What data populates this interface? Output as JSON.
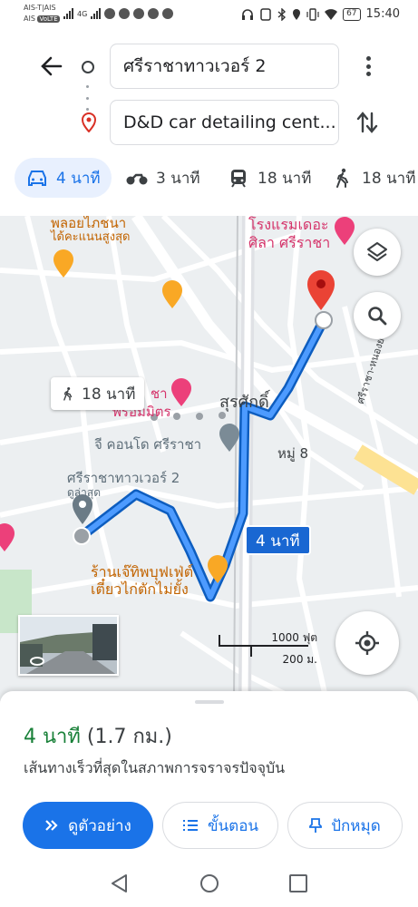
{
  "status_bar": {
    "carrier1": "AIS-T|AIS",
    "carrier2": "AIS",
    "carrier2_badge": "VoLTE",
    "network": "4G",
    "battery": "67",
    "time": "15:40"
  },
  "route": {
    "origin": "ศรีราชาทาวเวอร์ 2",
    "destination": "D&D car detailing cent..."
  },
  "modes": [
    {
      "label": "4 นาที",
      "icon": "car-icon",
      "active": true
    },
    {
      "label": "3 นาที",
      "icon": "motorcycle-icon",
      "active": false
    },
    {
      "label": "18 นาที",
      "icon": "transit-icon",
      "active": false
    },
    {
      "label": "18 นาที",
      "icon": "walk-icon",
      "active": false
    }
  ],
  "map": {
    "labels": {
      "top_left_place": "พลอยไภชนา",
      "top_left_rating": "ได้คะแนนสูงสุด",
      "hotel": "โรงแรมเดอะ",
      "hotel_line2": "ศิลา ศรีราชา",
      "area": "สุรศักดิ์",
      "poi_hotel_partial": "ชา",
      "poi_hotel_partial2": "พร้อมมิตร",
      "condo": "จี คอนโด ศรีราชา",
      "moo8": "หมู่ 8",
      "origin_label": "ศรีราชาทาวเวอร์ 2",
      "origin_sub": "ดูล่าสุด",
      "restaurant": "ร้านเจ๊ทิพบุฟเฟ่ต์",
      "restaurant_line2": "เตี๋ยวไก่ตักไม่ยั้ง",
      "road": "ศรีราชา-หนองยายบู่ 9"
    },
    "walk_chip": "18 นาที",
    "route_chip": "4 นาที",
    "scale_ft": "1000 ฟุต",
    "scale_m": "200 ม."
  },
  "summary": {
    "duration": "4 นาที",
    "distance": "(1.7 กม.)",
    "description": "เส้นทางเร็วที่สุดในสภาพการจราจรปัจจุบัน"
  },
  "buttons": {
    "preview": "ดูตัวอย่าง",
    "steps": "ขั้นตอน",
    "pin": "ปักหมุด"
  },
  "colors": {
    "accent": "#1a73e8",
    "route": "#1a73e8",
    "duration_green": "#188038",
    "pin_red": "#ea4335"
  }
}
